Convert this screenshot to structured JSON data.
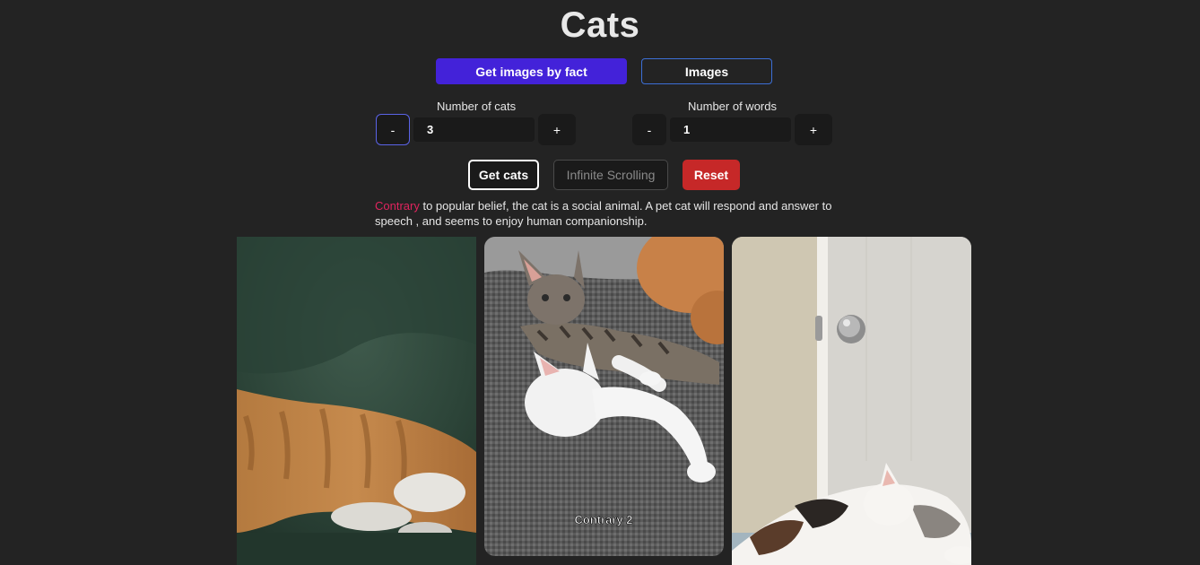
{
  "header": {
    "title": "Cats"
  },
  "modes": {
    "by_fact_label": "Get images by fact",
    "images_label": "Images"
  },
  "cats_control": {
    "label": "Number of cats",
    "minus_label": "-",
    "value": "3",
    "plus_label": "+"
  },
  "words_control": {
    "label": "Number of words",
    "minus_label": "-",
    "value": "1",
    "plus_label": "+"
  },
  "actions": {
    "get_cats_label": "Get cats",
    "infinite_label": "Infinite Scrolling",
    "reset_label": "Reset"
  },
  "fact": {
    "highlight": "Contrary",
    "rest": " to popular belief, the cat is a social animal. A pet cat will respond and answer to speech , and seems to enjoy human companionship."
  },
  "images": [
    {
      "caption": ""
    },
    {
      "caption": "Contrary 2"
    },
    {
      "caption": ""
    }
  ],
  "colors": {
    "primary": "#4322d9",
    "reset": "#c62828",
    "highlight": "#e0245e",
    "background": "#232323"
  }
}
